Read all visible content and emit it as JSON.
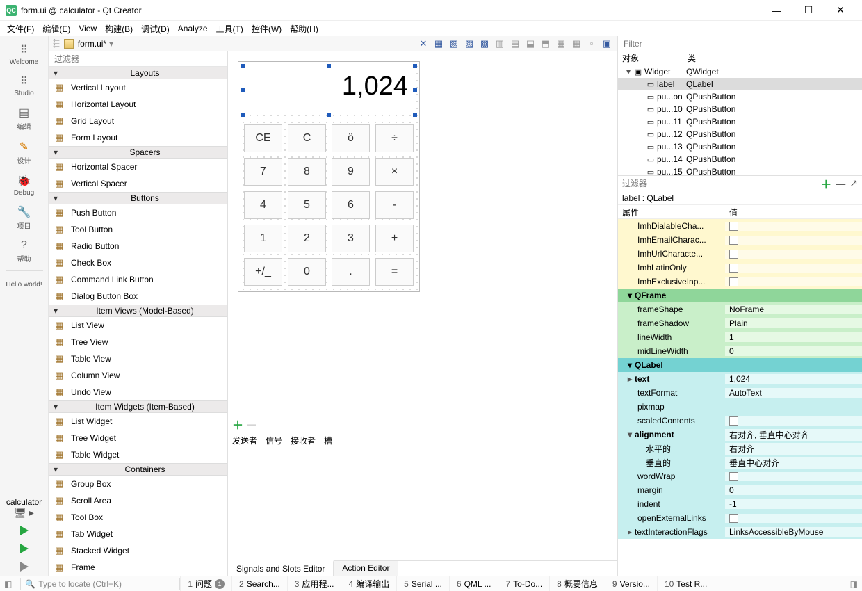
{
  "window": {
    "title": "form.ui @ calculator - Qt Creator"
  },
  "menu": [
    "文件(F)",
    "编辑(E)",
    "View",
    "构建(B)",
    "调试(D)",
    "Analyze",
    "工具(T)",
    "控件(W)",
    "帮助(H)"
  ],
  "left_rail": {
    "modes": [
      {
        "glyph": "⠿",
        "label": "Welcome"
      },
      {
        "glyph": "⠿",
        "label": "Studio"
      },
      {
        "glyph": "▤",
        "label": "编辑"
      },
      {
        "glyph": "✎",
        "label": "设计",
        "active": true
      },
      {
        "glyph": "🐞",
        "label": "Debug"
      },
      {
        "glyph": "🔧",
        "label": "项目"
      },
      {
        "glyph": "?",
        "label": "帮助"
      }
    ],
    "hello": "Hello world!",
    "project": "calculator"
  },
  "doc": {
    "name": "form.ui*"
  },
  "widgetbox": {
    "filter_placeholder": "过滤器",
    "groups": [
      {
        "title": "Layouts",
        "items": [
          "Vertical Layout",
          "Horizontal Layout",
          "Grid Layout",
          "Form Layout"
        ]
      },
      {
        "title": "Spacers",
        "items": [
          "Horizontal Spacer",
          "Vertical Spacer"
        ]
      },
      {
        "title": "Buttons",
        "items": [
          "Push Button",
          "Tool Button",
          "Radio Button",
          "Check Box",
          "Command Link Button",
          "Dialog Button Box"
        ]
      },
      {
        "title": "Item Views (Model-Based)",
        "items": [
          "List View",
          "Tree View",
          "Table View",
          "Column View",
          "Undo View"
        ]
      },
      {
        "title": "Item Widgets (Item-Based)",
        "items": [
          "List Widget",
          "Tree Widget",
          "Table Widget"
        ]
      },
      {
        "title": "Containers",
        "items": [
          "Group Box",
          "Scroll Area",
          "Tool Box",
          "Tab Widget",
          "Stacked Widget",
          "Frame"
        ]
      }
    ]
  },
  "canvas": {
    "display": "1,024",
    "keys": [
      "CE",
      "C",
      "ö",
      "÷",
      "7",
      "8",
      "9",
      "×",
      "4",
      "5",
      "6",
      "-",
      "1",
      "2",
      "3",
      "+",
      "+/_",
      "0",
      ".",
      "="
    ]
  },
  "signals": {
    "headers": [
      "发送者",
      "信号",
      "接收者",
      "槽"
    ],
    "tabs": [
      "Signals and Slots Editor",
      "Action Editor"
    ],
    "active_tab": 0
  },
  "object_inspector": {
    "filter_placeholder": "Filter",
    "col_headers": [
      "对象",
      "类"
    ],
    "rows": [
      {
        "indent": 0,
        "chev": "▾",
        "icon": "▣",
        "name": "Widget",
        "cls": "QWidget"
      },
      {
        "indent": 1,
        "icon": "▭",
        "name": "label",
        "cls": "QLabel",
        "selected": true
      },
      {
        "indent": 1,
        "icon": "▭",
        "name": "pu...on",
        "cls": "QPushButton"
      },
      {
        "indent": 1,
        "icon": "▭",
        "name": "pu...10",
        "cls": "QPushButton"
      },
      {
        "indent": 1,
        "icon": "▭",
        "name": "pu...11",
        "cls": "QPushButton"
      },
      {
        "indent": 1,
        "icon": "▭",
        "name": "pu...12",
        "cls": "QPushButton"
      },
      {
        "indent": 1,
        "icon": "▭",
        "name": "pu...13",
        "cls": "QPushButton"
      },
      {
        "indent": 1,
        "icon": "▭",
        "name": "pu...14",
        "cls": "QPushButton"
      },
      {
        "indent": 1,
        "icon": "▭",
        "name": "pu...15",
        "cls": "QPushButton"
      }
    ]
  },
  "property_editor": {
    "filter_placeholder": "过滤器",
    "class_label": "label : QLabel",
    "col_headers": [
      "属性",
      "值"
    ],
    "rows": [
      {
        "cls": "c-yel",
        "name": "ImhDialableCha...",
        "checkbox": true
      },
      {
        "cls": "c-yel",
        "name": "ImhEmailCharac...",
        "checkbox": true
      },
      {
        "cls": "c-yel",
        "name": "ImhUrlCharacte...",
        "checkbox": true
      },
      {
        "cls": "c-yel",
        "name": "ImhLatinOnly",
        "checkbox": true
      },
      {
        "cls": "c-yel",
        "name": "ImhExclusiveInp...",
        "checkbox": true
      },
      {
        "cls": "c-grn-h",
        "group": true,
        "chev": "▾",
        "name": "QFrame"
      },
      {
        "cls": "c-grn",
        "name": "frameShape",
        "value": "NoFrame"
      },
      {
        "cls": "c-grn",
        "name": "frameShadow",
        "value": "Plain"
      },
      {
        "cls": "c-grn",
        "name": "lineWidth",
        "value": "1"
      },
      {
        "cls": "c-grn",
        "name": "midLineWidth",
        "value": "0"
      },
      {
        "cls": "c-cyan-h",
        "group": true,
        "chev": "▾",
        "name": "QLabel"
      },
      {
        "cls": "c-cyan",
        "name": "text",
        "value": "1,024",
        "bold": true,
        "expand": true
      },
      {
        "cls": "c-cyan",
        "name": "textFormat",
        "value": "AutoText"
      },
      {
        "cls": "c-cyan",
        "name": "pixmap",
        "value": ""
      },
      {
        "cls": "c-cyan",
        "name": "scaledContents",
        "checkbox": true
      },
      {
        "cls": "c-cyan",
        "name": "alignment",
        "value": "右对齐, 垂直中心对齐",
        "bold": true,
        "expand": true,
        "open": true
      },
      {
        "cls": "c-cyan",
        "sub": true,
        "name": "水平的",
        "value": "右对齐"
      },
      {
        "cls": "c-cyan",
        "sub": true,
        "name": "垂直的",
        "value": "垂直中心对齐"
      },
      {
        "cls": "c-cyan",
        "name": "wordWrap",
        "checkbox": true
      },
      {
        "cls": "c-cyan",
        "name": "margin",
        "value": "0"
      },
      {
        "cls": "c-cyan",
        "name": "indent",
        "value": "-1"
      },
      {
        "cls": "c-cyan",
        "name": "openExternalLinks",
        "checkbox": true
      },
      {
        "cls": "c-cyan",
        "name": "textInteractionFlags",
        "value": "LinksAccessibleByMouse",
        "expand": true
      }
    ]
  },
  "statusbar": {
    "search_placeholder": "Type to locate (Ctrl+K)",
    "items": [
      {
        "n": "1",
        "label": "问题",
        "badge": "1"
      },
      {
        "n": "2",
        "label": "Search..."
      },
      {
        "n": "3",
        "label": "应用程..."
      },
      {
        "n": "4",
        "label": "编译输出"
      },
      {
        "n": "5",
        "label": "Serial ..."
      },
      {
        "n": "6",
        "label": "QML ..."
      },
      {
        "n": "7",
        "label": "To-Do..."
      },
      {
        "n": "8",
        "label": "概要信息"
      },
      {
        "n": "9",
        "label": "Versio..."
      },
      {
        "n": "10",
        "label": "Test R..."
      }
    ]
  }
}
